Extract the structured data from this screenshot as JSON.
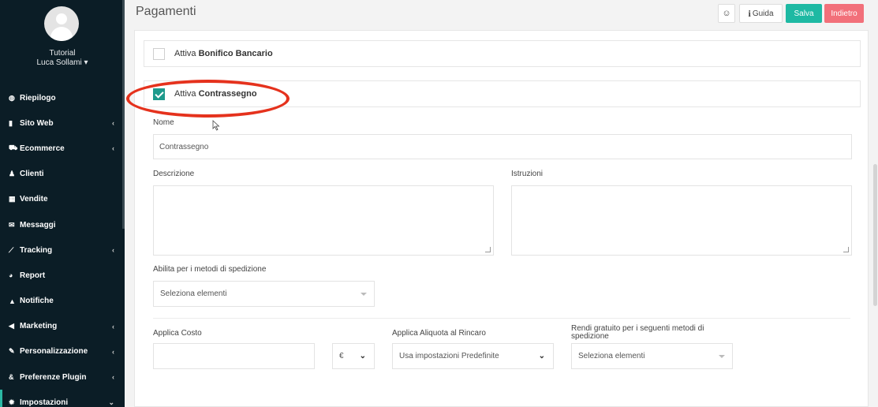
{
  "sidebar": {
    "user": {
      "line1": "Tutorial",
      "line2": "Luca Sollami ▾"
    },
    "items": [
      {
        "label": "Riepilogo",
        "icon": "dashboard-icon",
        "glyph": "◍",
        "chevron": ""
      },
      {
        "label": "Sito Web",
        "icon": "file-icon",
        "glyph": "▮",
        "chevron": "‹"
      },
      {
        "label": "Ecommerce",
        "icon": "cart-icon",
        "glyph": "⛟",
        "chevron": "‹"
      },
      {
        "label": "Clienti",
        "icon": "user-icon",
        "glyph": "♟",
        "chevron": ""
      },
      {
        "label": "Vendite",
        "icon": "calculator-icon",
        "glyph": "▦",
        "chevron": ""
      },
      {
        "label": "Messaggi",
        "icon": "envelope-icon",
        "glyph": "✉",
        "chevron": ""
      },
      {
        "label": "Tracking",
        "icon": "chart-line-icon",
        "glyph": "⟋",
        "chevron": "‹"
      },
      {
        "label": "Report",
        "icon": "pie-chart-icon",
        "glyph": "◕",
        "chevron": ""
      },
      {
        "label": "Notifiche",
        "icon": "bell-icon",
        "glyph": "▲",
        "chevron": ""
      },
      {
        "label": "Marketing",
        "icon": "megaphone-icon",
        "glyph": "◀",
        "chevron": "‹"
      },
      {
        "label": "Personalizzazione",
        "icon": "brush-icon",
        "glyph": "✎",
        "chevron": "‹"
      },
      {
        "label": "Preferenze Plugin",
        "icon": "plugin-icon",
        "glyph": "&",
        "chevron": "‹"
      },
      {
        "label": "Impostazioni",
        "icon": "gear-icon",
        "glyph": "✹",
        "chevron": "⌄"
      }
    ]
  },
  "header": {
    "title": "Pagamenti",
    "smile_glyph": "☺",
    "guida_glyph": "i",
    "guida_label": "Guida",
    "salva_label": "Salva",
    "indietro_label": "Indietro"
  },
  "payments": {
    "bonifico": {
      "prefix": "Attiva",
      "name": "Bonifico Bancario",
      "checked": false
    },
    "contrassegno": {
      "prefix": "Attiva",
      "name": "Contrassegno",
      "checked": true
    }
  },
  "form": {
    "nome_label": "Nome",
    "nome_value": "Contrassegno",
    "descrizione_label": "Descrizione",
    "istruzioni_label": "Istruzioni",
    "spedizione_label": "Abilita per i metodi di spedizione",
    "spedizione_placeholder": "Seleziona elementi",
    "costo_label": "Applica Costo",
    "currency_value": "€",
    "aliquota_label": "Applica Aliquota al Rincaro",
    "aliquota_value": "Usa impostazioni Predefinite",
    "gratuito_label": "Rendi gratuito per i seguenti metodi di spedizione",
    "gratuito_placeholder": "Seleziona elementi",
    "chevron_glyph": "⌄"
  },
  "colors": {
    "sidebar_bg": "#0b1d26",
    "accent": "#1eb9a3",
    "danger": "#f2707a",
    "annotation": "#e5321d"
  }
}
